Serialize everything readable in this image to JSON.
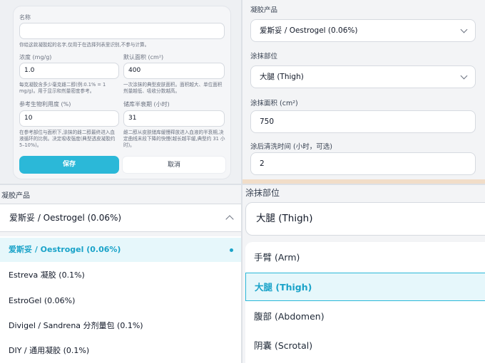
{
  "form": {
    "name_label": "名称",
    "name_value": "",
    "name_help": "你给这款凝胶起的名字,仅用于在选择列表里识别,不参与计算。",
    "conc_label": "浓度 (mg/g)",
    "conc_value": "1.0",
    "conc_help": "每克凝胶含多少毫克雌二醇(例:0.1% = 1 mg/g)。用于显示和剂量密度参考。",
    "area_label": "默认面积 (cm²)",
    "area_value": "400",
    "area_help": "一次涂抹的典型皮肤面积。面积越大、单位面积剂量越低、吸收分数越高。",
    "bio_label": "参考生物利用度 (%)",
    "bio_value": "10",
    "bio_help": "在参考部位与面积下,涂抹的雌二醇最终进入血液循环的比例。决定吸收强度(典型透皮凝胶约 5–10%)。",
    "half_label": "储库半衰期 (小时)",
    "half_value": "31",
    "half_help": "雌二醇从皮肤储库缓慢释放进入血液的半衰期,决定曲线末段下降的快慢(越长越平缓,典型约 31 小时)。",
    "save_label": "保存",
    "cancel_label": "取消"
  },
  "panel": {
    "product_label": "凝胶产品",
    "product_value": "爱斯妥 / Oestrogel (0.06%)",
    "site_label": "涂抹部位",
    "site_value": "大腿 (Thigh)",
    "area_label": "涂抹面积 (cm²)",
    "area_value": "750",
    "wash_label": "涂后清洗时间 (小时，可选)",
    "wash_value": "2"
  },
  "product_dropdown": {
    "title": "凝胶产品",
    "selected": "爱斯妥 / Oestrogel (0.06%)",
    "options": [
      "爱斯妥 / Oestrogel (0.06%)",
      "Estreva 凝胶 (0.1%)",
      "EstroGel (0.06%)",
      "Divigel / Sandrena 分剂量包 (0.1%)",
      "DIY / 通用凝胶 (0.1%)"
    ]
  },
  "site_dropdown": {
    "title": "涂抹部位",
    "selected": "大腿 (Thigh)",
    "options": [
      "手臂 (Arm)",
      "大腿 (Thigh)",
      "腹部 (Abdomen)",
      "阴囊 (Scrotal)"
    ]
  },
  "colors": {
    "accent": "#2bb8d8",
    "selected_bg": "#e6f7fb",
    "selected_text": "#1aa3c9"
  }
}
